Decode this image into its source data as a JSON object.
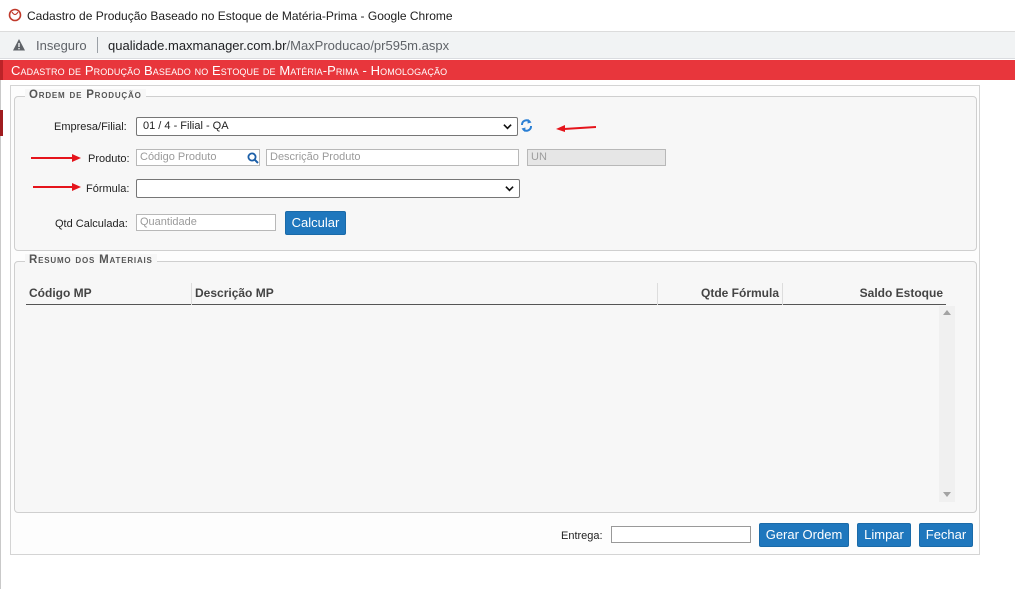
{
  "browser": {
    "window_title": "Cadastro de Produção Baseado no Estoque de Matéria-Prima - Google Chrome",
    "security_label": "Inseguro",
    "url_host": "qualidade.maxmanager.com.br",
    "url_path": "/MaxProducao/pr595m.aspx"
  },
  "page": {
    "header_title": "Cadastro de Produção Baseado no Estoque de Matéria-Prima  - Homologação"
  },
  "ordem": {
    "legend": "Ordem de Produção",
    "empresa_label": "Empresa/Filial:",
    "empresa_value": "01 / 4 - Filial - QA",
    "produto_label": "Produto:",
    "codigo_placeholder": "Código Produto",
    "descricao_placeholder": "Descrição Produto",
    "unidade_value": "UN",
    "formula_label": "Fórmula:",
    "formula_value": "",
    "qtd_label": "Qtd Calculada:",
    "qtd_placeholder": "Quantidade",
    "calcular_label": "Calcular"
  },
  "resumo": {
    "legend": "Resumo dos Materiais",
    "columns": [
      "Código MP",
      "Descrição MP",
      "Qtde Fórmula",
      "Saldo Estoque"
    ],
    "rows": []
  },
  "footer": {
    "entrega_label": "Entrega:",
    "entrega_value": "",
    "gerar_label": "Gerar Ordem",
    "limpar_label": "Limpar",
    "fechar_label": "Fechar"
  },
  "colors": {
    "header_red": "#e8363c",
    "button_blue": "#1f77bd",
    "annotation_arrow": "#e5141b"
  },
  "icons": [
    "chrome-app-icon",
    "warning-icon",
    "refresh-icon",
    "search-icon",
    "chevron-down-icon",
    "scroll-up-icon",
    "scroll-down-icon"
  ]
}
